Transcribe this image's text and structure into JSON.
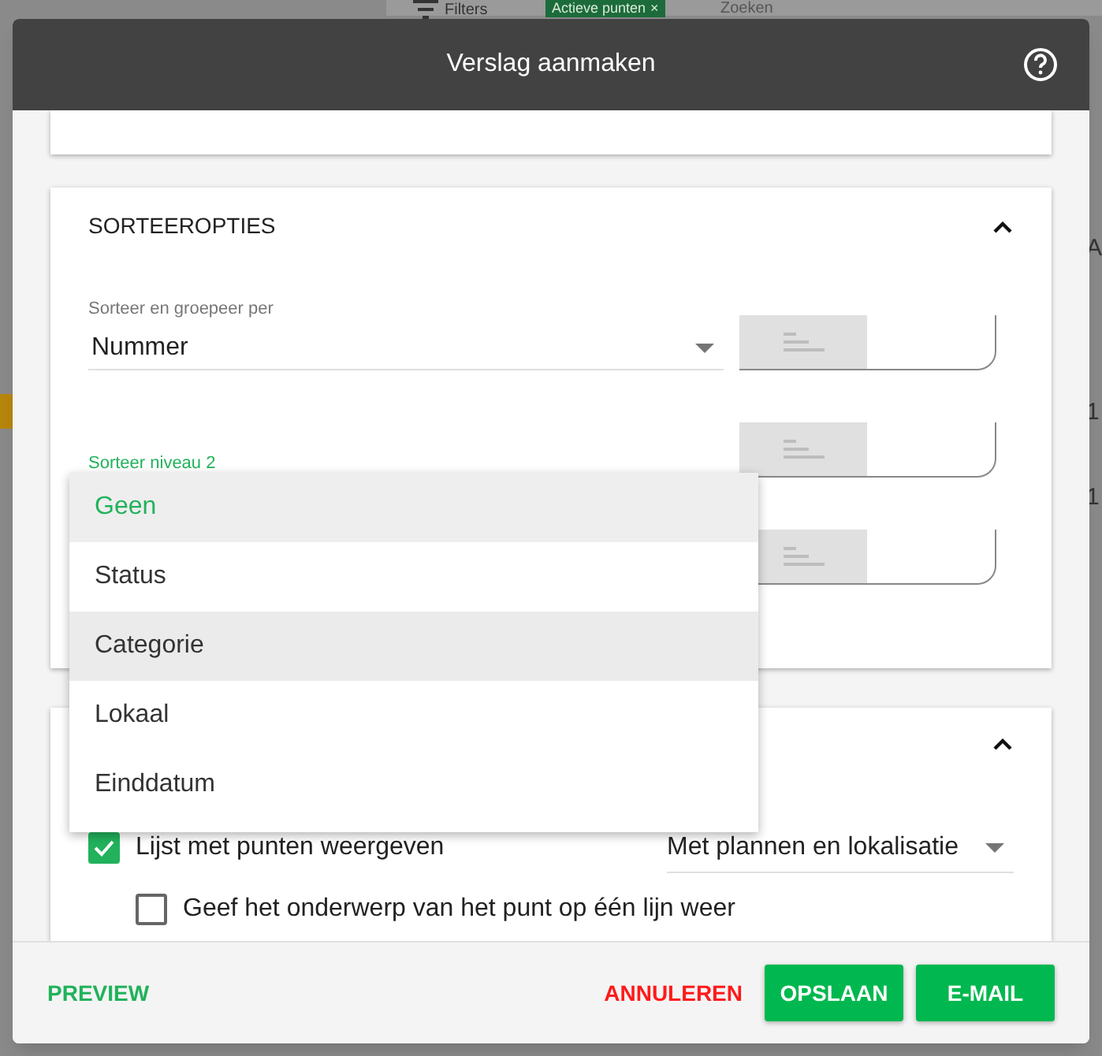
{
  "background": {
    "filter_button": "Filters",
    "active_tag": "Actieve punten",
    "tag_close": "×",
    "search_placeholder": "Zoeken",
    "edge_texts": [
      "A",
      "1",
      "1"
    ]
  },
  "dialog": {
    "title": "Verslag aanmaken"
  },
  "sort_card": {
    "title": "SORTEEROPTIES",
    "expanded": true,
    "rows": [
      {
        "label": "Sorteer en groepeer per",
        "value": "Nummer",
        "focused": false
      },
      {
        "label": "Sorteer niveau 2",
        "focused": true
      },
      {}
    ]
  },
  "dropdown": {
    "options": [
      {
        "label": "Geen",
        "selected": true,
        "hovered": false
      },
      {
        "label": "Status",
        "selected": false,
        "hovered": false
      },
      {
        "label": "Categorie",
        "selected": false,
        "hovered": true
      },
      {
        "label": "Lokaal",
        "selected": false,
        "hovered": false
      },
      {
        "label": "Einddatum",
        "selected": false,
        "hovered": false
      }
    ]
  },
  "content_card": {
    "expanded": true,
    "options": [
      {
        "label": "Lijst met punten weergeven",
        "checked": true,
        "select": "Met plannen en lokalisatie",
        "children": [
          {
            "label": "Geef het onderwerp van het punt op één lijn weer",
            "checked": false
          }
        ]
      }
    ]
  },
  "footer": {
    "preview": "PREVIEW",
    "cancel": "ANNULEREN",
    "buttons": [
      "OPSLAAN",
      "E-MAIL"
    ]
  }
}
